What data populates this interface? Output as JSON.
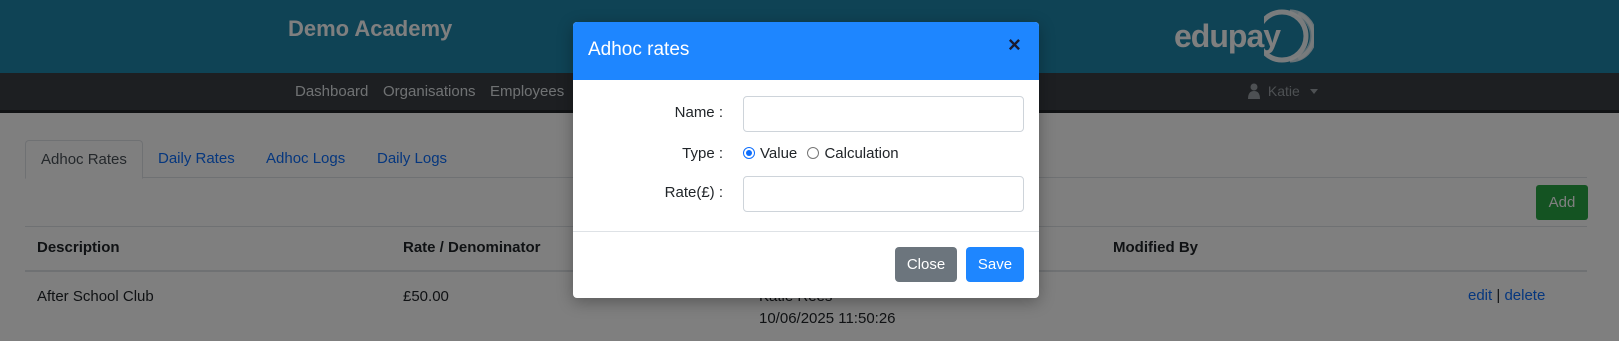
{
  "header": {
    "brand": "Demo Academy",
    "logo_text": "edupay"
  },
  "nav": {
    "items": [
      "Dashboard",
      "Organisations",
      "Employees"
    ],
    "user": "Katie"
  },
  "tabs": [
    {
      "label": "Adhoc Rates",
      "active": true
    },
    {
      "label": "Daily Rates",
      "active": false
    },
    {
      "label": "Adhoc Logs",
      "active": false
    },
    {
      "label": "Daily Logs",
      "active": false
    }
  ],
  "toolbar": {
    "add_label": "Add"
  },
  "table": {
    "columns": [
      "Description",
      "Rate / Denominator",
      "Modified By"
    ],
    "rows": [
      {
        "description": "After School Club",
        "rate": "£50.00",
        "modified_name": "Katie Rees",
        "modified_date": "10/06/2025 11:50:26",
        "edit_label": "edit",
        "separator": "|",
        "delete_label": "delete"
      }
    ]
  },
  "modal": {
    "title": "Adhoc rates",
    "close_symbol": "×",
    "fields": {
      "name_label": "Name :",
      "name_value": "",
      "type_label": "Type :",
      "type_options": [
        {
          "label": "Value",
          "checked": true
        },
        {
          "label": "Calculation",
          "checked": false
        }
      ],
      "rate_label": "Rate(£) :",
      "rate_value": ""
    },
    "close_label": "Close",
    "save_label": "Save"
  },
  "colors": {
    "header_bg": "#1e86ab",
    "nav_bg": "#3a3f44",
    "modal_header_bg": "#1e86ff",
    "primary": "#1e86ff",
    "success": "#28a745",
    "secondary": "#6c757d"
  }
}
